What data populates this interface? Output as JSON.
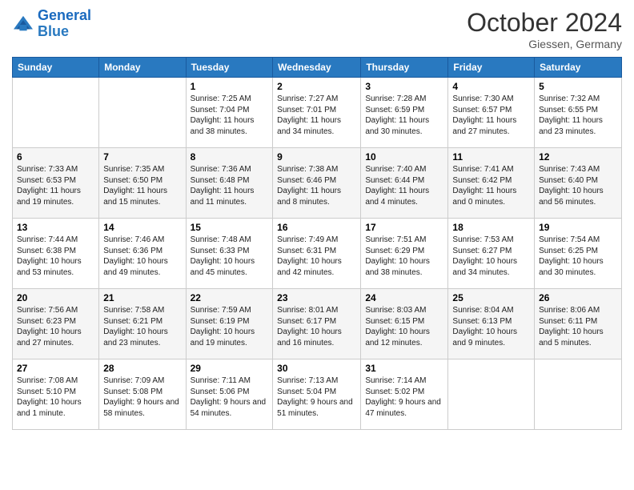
{
  "header": {
    "logo": {
      "line1": "General",
      "line2": "Blue"
    },
    "month": "October 2024",
    "location": "Giessen, Germany"
  },
  "weekdays": [
    "Sunday",
    "Monday",
    "Tuesday",
    "Wednesday",
    "Thursday",
    "Friday",
    "Saturday"
  ],
  "rows": [
    [
      {
        "num": "",
        "sunrise": "",
        "sunset": "",
        "daylight": ""
      },
      {
        "num": "",
        "sunrise": "",
        "sunset": "",
        "daylight": ""
      },
      {
        "num": "1",
        "sunrise": "Sunrise: 7:25 AM",
        "sunset": "Sunset: 7:04 PM",
        "daylight": "Daylight: 11 hours and 38 minutes."
      },
      {
        "num": "2",
        "sunrise": "Sunrise: 7:27 AM",
        "sunset": "Sunset: 7:01 PM",
        "daylight": "Daylight: 11 hours and 34 minutes."
      },
      {
        "num": "3",
        "sunrise": "Sunrise: 7:28 AM",
        "sunset": "Sunset: 6:59 PM",
        "daylight": "Daylight: 11 hours and 30 minutes."
      },
      {
        "num": "4",
        "sunrise": "Sunrise: 7:30 AM",
        "sunset": "Sunset: 6:57 PM",
        "daylight": "Daylight: 11 hours and 27 minutes."
      },
      {
        "num": "5",
        "sunrise": "Sunrise: 7:32 AM",
        "sunset": "Sunset: 6:55 PM",
        "daylight": "Daylight: 11 hours and 23 minutes."
      }
    ],
    [
      {
        "num": "6",
        "sunrise": "Sunrise: 7:33 AM",
        "sunset": "Sunset: 6:53 PM",
        "daylight": "Daylight: 11 hours and 19 minutes."
      },
      {
        "num": "7",
        "sunrise": "Sunrise: 7:35 AM",
        "sunset": "Sunset: 6:50 PM",
        "daylight": "Daylight: 11 hours and 15 minutes."
      },
      {
        "num": "8",
        "sunrise": "Sunrise: 7:36 AM",
        "sunset": "Sunset: 6:48 PM",
        "daylight": "Daylight: 11 hours and 11 minutes."
      },
      {
        "num": "9",
        "sunrise": "Sunrise: 7:38 AM",
        "sunset": "Sunset: 6:46 PM",
        "daylight": "Daylight: 11 hours and 8 minutes."
      },
      {
        "num": "10",
        "sunrise": "Sunrise: 7:40 AM",
        "sunset": "Sunset: 6:44 PM",
        "daylight": "Daylight: 11 hours and 4 minutes."
      },
      {
        "num": "11",
        "sunrise": "Sunrise: 7:41 AM",
        "sunset": "Sunset: 6:42 PM",
        "daylight": "Daylight: 11 hours and 0 minutes."
      },
      {
        "num": "12",
        "sunrise": "Sunrise: 7:43 AM",
        "sunset": "Sunset: 6:40 PM",
        "daylight": "Daylight: 10 hours and 56 minutes."
      }
    ],
    [
      {
        "num": "13",
        "sunrise": "Sunrise: 7:44 AM",
        "sunset": "Sunset: 6:38 PM",
        "daylight": "Daylight: 10 hours and 53 minutes."
      },
      {
        "num": "14",
        "sunrise": "Sunrise: 7:46 AM",
        "sunset": "Sunset: 6:36 PM",
        "daylight": "Daylight: 10 hours and 49 minutes."
      },
      {
        "num": "15",
        "sunrise": "Sunrise: 7:48 AM",
        "sunset": "Sunset: 6:33 PM",
        "daylight": "Daylight: 10 hours and 45 minutes."
      },
      {
        "num": "16",
        "sunrise": "Sunrise: 7:49 AM",
        "sunset": "Sunset: 6:31 PM",
        "daylight": "Daylight: 10 hours and 42 minutes."
      },
      {
        "num": "17",
        "sunrise": "Sunrise: 7:51 AM",
        "sunset": "Sunset: 6:29 PM",
        "daylight": "Daylight: 10 hours and 38 minutes."
      },
      {
        "num": "18",
        "sunrise": "Sunrise: 7:53 AM",
        "sunset": "Sunset: 6:27 PM",
        "daylight": "Daylight: 10 hours and 34 minutes."
      },
      {
        "num": "19",
        "sunrise": "Sunrise: 7:54 AM",
        "sunset": "Sunset: 6:25 PM",
        "daylight": "Daylight: 10 hours and 30 minutes."
      }
    ],
    [
      {
        "num": "20",
        "sunrise": "Sunrise: 7:56 AM",
        "sunset": "Sunset: 6:23 PM",
        "daylight": "Daylight: 10 hours and 27 minutes."
      },
      {
        "num": "21",
        "sunrise": "Sunrise: 7:58 AM",
        "sunset": "Sunset: 6:21 PM",
        "daylight": "Daylight: 10 hours and 23 minutes."
      },
      {
        "num": "22",
        "sunrise": "Sunrise: 7:59 AM",
        "sunset": "Sunset: 6:19 PM",
        "daylight": "Daylight: 10 hours and 19 minutes."
      },
      {
        "num": "23",
        "sunrise": "Sunrise: 8:01 AM",
        "sunset": "Sunset: 6:17 PM",
        "daylight": "Daylight: 10 hours and 16 minutes."
      },
      {
        "num": "24",
        "sunrise": "Sunrise: 8:03 AM",
        "sunset": "Sunset: 6:15 PM",
        "daylight": "Daylight: 10 hours and 12 minutes."
      },
      {
        "num": "25",
        "sunrise": "Sunrise: 8:04 AM",
        "sunset": "Sunset: 6:13 PM",
        "daylight": "Daylight: 10 hours and 9 minutes."
      },
      {
        "num": "26",
        "sunrise": "Sunrise: 8:06 AM",
        "sunset": "Sunset: 6:11 PM",
        "daylight": "Daylight: 10 hours and 5 minutes."
      }
    ],
    [
      {
        "num": "27",
        "sunrise": "Sunrise: 7:08 AM",
        "sunset": "Sunset: 5:10 PM",
        "daylight": "Daylight: 10 hours and 1 minute."
      },
      {
        "num": "28",
        "sunrise": "Sunrise: 7:09 AM",
        "sunset": "Sunset: 5:08 PM",
        "daylight": "Daylight: 9 hours and 58 minutes."
      },
      {
        "num": "29",
        "sunrise": "Sunrise: 7:11 AM",
        "sunset": "Sunset: 5:06 PM",
        "daylight": "Daylight: 9 hours and 54 minutes."
      },
      {
        "num": "30",
        "sunrise": "Sunrise: 7:13 AM",
        "sunset": "Sunset: 5:04 PM",
        "daylight": "Daylight: 9 hours and 51 minutes."
      },
      {
        "num": "31",
        "sunrise": "Sunrise: 7:14 AM",
        "sunset": "Sunset: 5:02 PM",
        "daylight": "Daylight: 9 hours and 47 minutes."
      },
      {
        "num": "",
        "sunrise": "",
        "sunset": "",
        "daylight": ""
      },
      {
        "num": "",
        "sunrise": "",
        "sunset": "",
        "daylight": ""
      }
    ]
  ]
}
